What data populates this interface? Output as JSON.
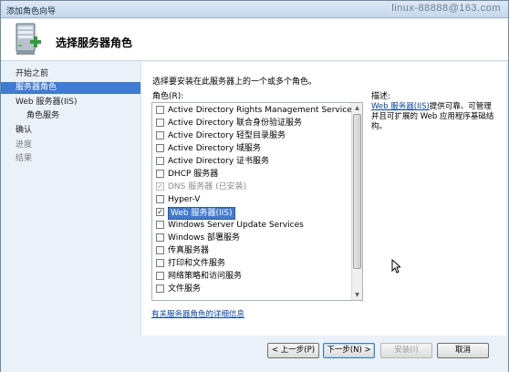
{
  "window": {
    "title": "添加角色向导",
    "watermark": "linux-88888@163.com"
  },
  "header": {
    "page_title": "选择服务器角色"
  },
  "nav": {
    "items": [
      {
        "label": "开始之前",
        "state": "normal",
        "level": 0
      },
      {
        "label": "服务器角色",
        "state": "selected",
        "level": 0
      },
      {
        "label": "Web 服务器(IIS)",
        "state": "normal",
        "level": 0
      },
      {
        "label": "角色服务",
        "state": "normal",
        "level": 1
      },
      {
        "label": "确认",
        "state": "normal",
        "level": 0
      },
      {
        "label": "进度",
        "state": "disabled",
        "level": 0
      },
      {
        "label": "结果",
        "state": "disabled",
        "level": 0
      }
    ]
  },
  "content": {
    "instruction": "选择要安装在此服务器上的一个或多个角色。",
    "roles_label": "角色(R):",
    "roles": [
      {
        "label": "Active Directory Rights Management Services",
        "checked": false,
        "disabled": false
      },
      {
        "label": "Active Directory 联合身份验证服务",
        "checked": false,
        "disabled": false
      },
      {
        "label": "Active Directory 轻型目录服务",
        "checked": false,
        "disabled": false
      },
      {
        "label": "Active Directory 域服务",
        "checked": false,
        "disabled": false
      },
      {
        "label": "Active Directory 证书服务",
        "checked": false,
        "disabled": false
      },
      {
        "label": "DHCP 服务器",
        "checked": false,
        "disabled": false
      },
      {
        "label": "DNS 服务器  (已安装)",
        "checked": true,
        "disabled": true
      },
      {
        "label": "Hyper-V",
        "checked": false,
        "disabled": false
      },
      {
        "label": "Web 服务器(IIS)",
        "checked": true,
        "disabled": false,
        "highlight": true
      },
      {
        "label": "Windows Server Update Services",
        "checked": false,
        "disabled": false
      },
      {
        "label": "Windows 部署服务",
        "checked": false,
        "disabled": false
      },
      {
        "label": "传真服务器",
        "checked": false,
        "disabled": false
      },
      {
        "label": "打印和文件服务",
        "checked": false,
        "disabled": false
      },
      {
        "label": "网络策略和访问服务",
        "checked": false,
        "disabled": false
      },
      {
        "label": "文件服务",
        "checked": false,
        "disabled": false
      }
    ],
    "description_label": "描述:",
    "description_link": "Web 服务器(IIS)",
    "description_text": "提供可靠、可管理并且可扩展的 Web 应用程序基础结构。",
    "more_info_link": "有关服务器角色的详细信息"
  },
  "footer": {
    "prev": "< 上一步(P)",
    "next": "下一步(N) >",
    "install": "安装(I)",
    "cancel": "取消"
  }
}
